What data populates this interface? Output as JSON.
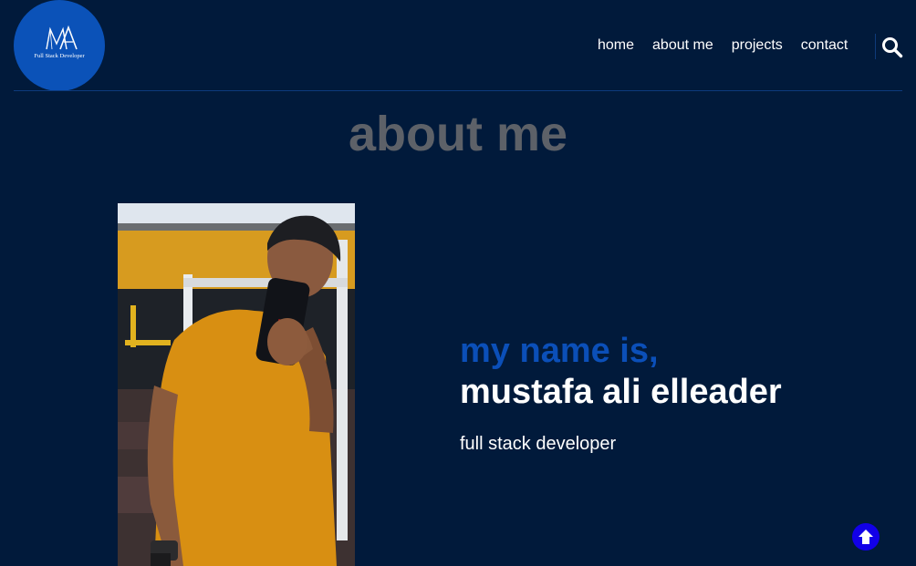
{
  "header": {
    "logo_monogram": "MA",
    "logo_tagline": "Full Stack Developer",
    "nav": [
      "home",
      "about me",
      "projects",
      "contact"
    ],
    "search_icon": "search-icon"
  },
  "about": {
    "title": "about me",
    "greeting": "my name is,",
    "name": "mustafa ali elleader",
    "role": "full stack developer"
  },
  "scroll_top_icon": "arrow-up-icon",
  "colors": {
    "background": "#011a3b",
    "accent": "#0b4fb8",
    "title_gray": "#5d6168",
    "scroll_button": "#1200e8"
  }
}
